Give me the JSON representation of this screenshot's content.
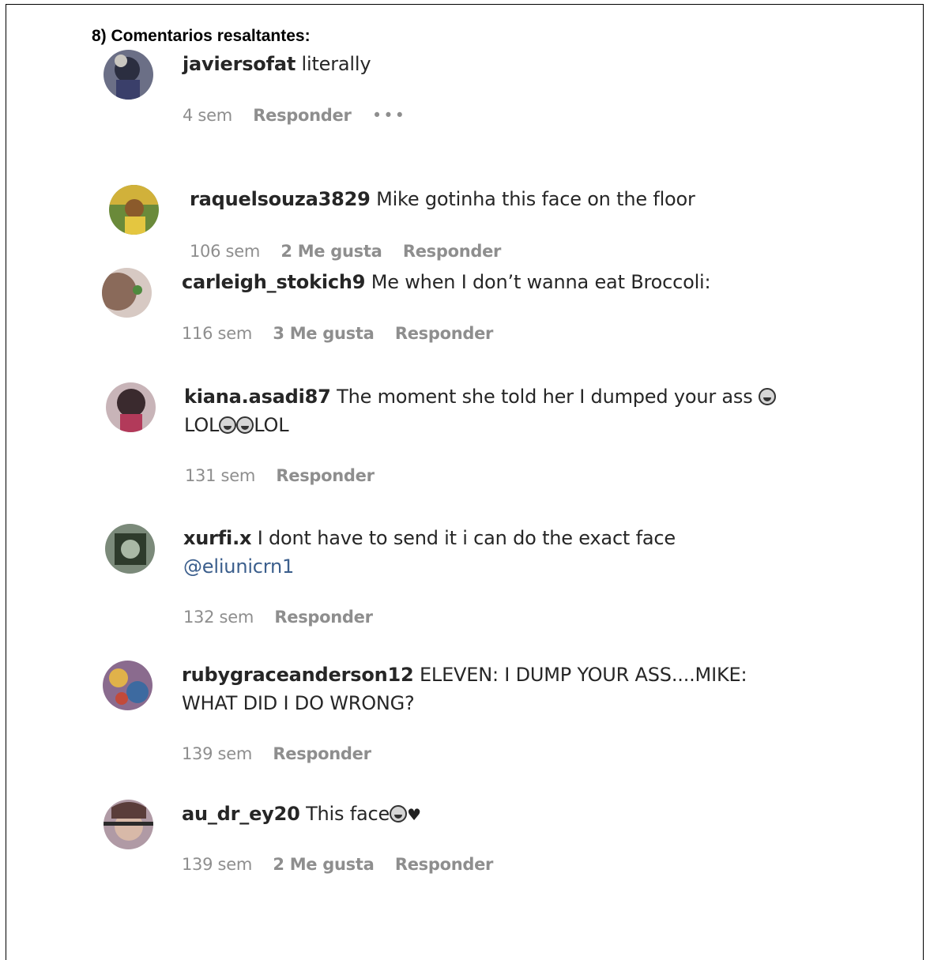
{
  "heading": "8) Comentarios resaltantes:",
  "comments": [
    {
      "user": "javiersofat",
      "text": "literally",
      "time": "4 sem",
      "likes": "",
      "reply": "Responder",
      "more": "•••"
    },
    {
      "user": "raquelsouza3829",
      "text": "Mike gotinha this face on the floor",
      "time": "106 sem",
      "likes": "2 Me gusta",
      "reply": "Responder"
    },
    {
      "user": "carleigh_stokich9",
      "text": "Me when I don’t wanna eat Broccoli:",
      "time": "116 sem",
      "likes": "3 Me gusta",
      "reply": "Responder"
    },
    {
      "user": "kiana.asadi87",
      "text": "The moment she told her I dumped your ass",
      "text2a": "LOL",
      "text2b": "LOL",
      "time": "131 sem",
      "likes": "",
      "reply": "Responder"
    },
    {
      "user": "xurfi.x",
      "text": "I dont have to send it i can do the exact face",
      "mention": "@eliunicrn1",
      "time": "132 sem",
      "likes": "",
      "reply": "Responder"
    },
    {
      "user": "rubygraceanderson12",
      "text": "ELEVEN: I DUMP YOUR ASS....MIKE:",
      "text2": "WHAT DID I DO WRONG?",
      "time": "139 sem",
      "likes": "",
      "reply": "Responder"
    },
    {
      "user": "au_dr_ey20",
      "text": "This face",
      "time": "139 sem",
      "likes": "2 Me gusta",
      "reply": "Responder"
    }
  ],
  "icons": [
    "laughing-emoji-icon",
    "black-heart-icon",
    "more-options-icon"
  ]
}
